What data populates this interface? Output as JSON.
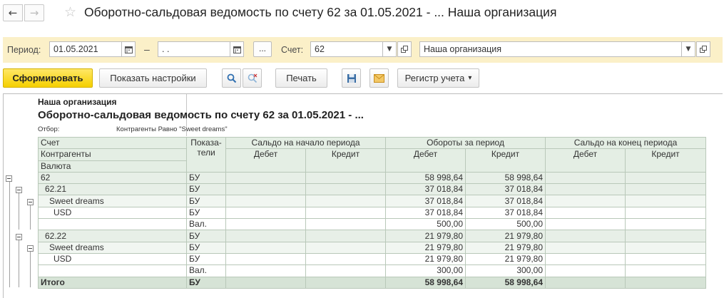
{
  "window": {
    "title": "Оборотно-сальдовая ведомость по счету 62 за 01.05.2021 - ... Наша организация",
    "back_icon": "←",
    "forward_icon": "→",
    "star_icon": "☆"
  },
  "params": {
    "period_label": "Период:",
    "date_from": "01.05.2021",
    "dash": "–",
    "date_to": " .  .",
    "dots_label": "...",
    "account_label": "Счет:",
    "account_value": "62",
    "org_value": "Наша организация"
  },
  "toolbar": {
    "generate": "Сформировать",
    "show_settings": "Показать настройки",
    "print": "Печать",
    "register": "Регистр учета",
    "register_arrow": "▾"
  },
  "report": {
    "organization": "Наша организация",
    "title": "Оборотно-сальдовая ведомость по счету 62 за 01.05.2021 - ...",
    "filter_label": "Отбор:",
    "filter_value": "Контрагенты Равно \"Sweet dreams\"",
    "headers": {
      "account": "Счет",
      "counterparties": "Контрагенты",
      "currency": "Валюта",
      "indicators": "Показа-\nтели",
      "opening": "Сальдо на начало периода",
      "turnover": "Обороты за период",
      "closing": "Сальдо на конец периода",
      "debit": "Дебет",
      "credit": "Кредит"
    },
    "rows": [
      {
        "name": "62",
        "ind": "БУ",
        "od": "",
        "oc": "",
        "td": "58 998,64",
        "tc": "58 998,64",
        "cd": "",
        "cc": ""
      },
      {
        "name": "62.21",
        "ind": "БУ",
        "od": "",
        "oc": "",
        "td": "37 018,84",
        "tc": "37 018,84",
        "cd": "",
        "cc": ""
      },
      {
        "name": "Sweet dreams",
        "ind": "БУ",
        "od": "",
        "oc": "",
        "td": "37 018,84",
        "tc": "37 018,84",
        "cd": "",
        "cc": ""
      },
      {
        "name": "USD",
        "ind": "БУ",
        "od": "",
        "oc": "",
        "td": "37 018,84",
        "tc": "37 018,84",
        "cd": "",
        "cc": ""
      },
      {
        "name": "",
        "ind": "Вал.",
        "od": "",
        "oc": "",
        "td": "500,00",
        "tc": "500,00",
        "cd": "",
        "cc": ""
      },
      {
        "name": "62.22",
        "ind": "БУ",
        "od": "",
        "oc": "",
        "td": "21 979,80",
        "tc": "21 979,80",
        "cd": "",
        "cc": ""
      },
      {
        "name": "Sweet dreams",
        "ind": "БУ",
        "od": "",
        "oc": "",
        "td": "21 979,80",
        "tc": "21 979,80",
        "cd": "",
        "cc": ""
      },
      {
        "name": "USD",
        "ind": "БУ",
        "od": "",
        "oc": "",
        "td": "21 979,80",
        "tc": "21 979,80",
        "cd": "",
        "cc": ""
      },
      {
        "name": "",
        "ind": "Вал.",
        "od": "",
        "oc": "",
        "td": "300,00",
        "tc": "300,00",
        "cd": "",
        "cc": ""
      },
      {
        "name": "Итого",
        "ind": "БУ",
        "od": "",
        "oc": "",
        "td": "58 998,64",
        "tc": "58 998,64",
        "cd": "",
        "cc": ""
      }
    ]
  },
  "colors": {
    "accent_yellow": "#f5d000",
    "param_panel": "#fbf0c8",
    "table_header": "#e4eee4"
  }
}
